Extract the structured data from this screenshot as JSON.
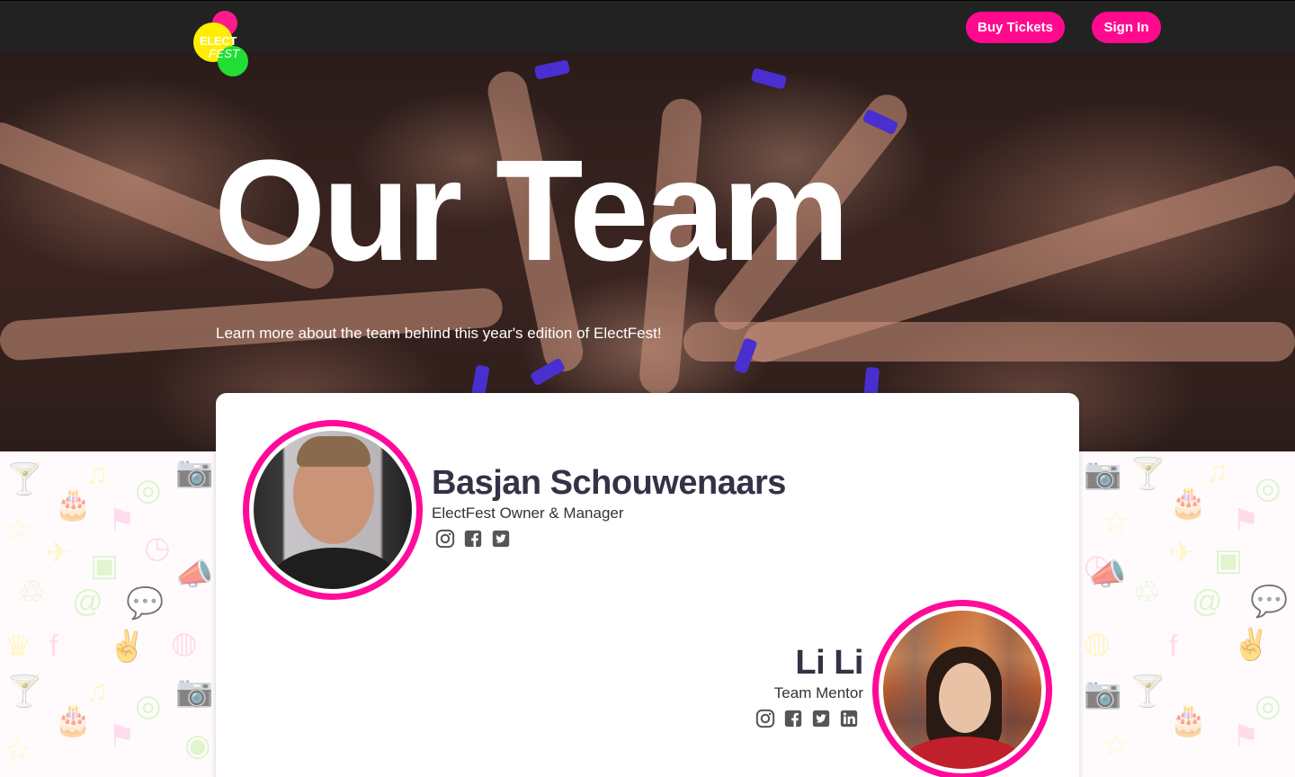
{
  "nav": {
    "logo_top": "ELECT",
    "logo_bottom": "FEST",
    "buy_tickets_label": "Buy Tickets",
    "sign_in_label": "Sign In"
  },
  "hero": {
    "title": "Our Team",
    "subtitle": "Learn more about the team behind this year's edition of ElectFest!"
  },
  "team": [
    {
      "name": "Basjan Schouwenaars",
      "role": "ElectFest Owner & Manager",
      "socials": [
        "instagram-icon",
        "facebook-icon",
        "twitter-icon"
      ]
    },
    {
      "name": "Li Li",
      "role": "Team Mentor",
      "socials": [
        "instagram-icon",
        "facebook-icon",
        "twitter-icon",
        "linkedin-icon"
      ]
    }
  ],
  "colors": {
    "accent": "#ff0a8e",
    "navbar": "#222222",
    "name_text": "#333347",
    "icon": "#555555"
  }
}
